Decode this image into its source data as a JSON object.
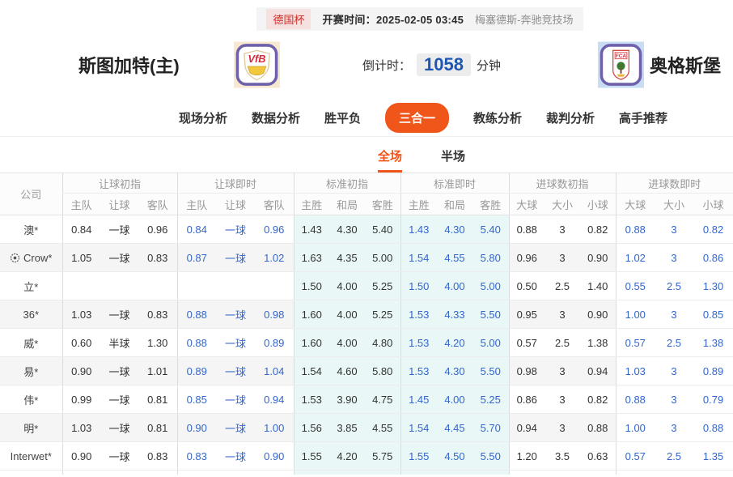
{
  "colors": {
    "accent_orange": "#f0551a",
    "live_blue": "#3366cc",
    "standard_column_bg": "#e9f7f7",
    "league_badge_red": "#c9302c",
    "countdown_blue": "#1e56b0"
  },
  "top_bar": {
    "league": "德国杯",
    "kickoff_label": "开赛时间：",
    "kickoff_time": "2025-02-05 03:45",
    "venue": "梅塞德斯-奔驰竞技场"
  },
  "match_header": {
    "home_team": "斯图加特(主)",
    "home_logo_text": "VfB",
    "away_team": "奥格斯堡",
    "away_logo_text": "FCA",
    "countdown_label": "倒计时：",
    "countdown_value": "1058",
    "countdown_unit": "分钟"
  },
  "nav_tabs": [
    {
      "label": "现场分析",
      "active": false
    },
    {
      "label": "数据分析",
      "active": false
    },
    {
      "label": "胜平负",
      "active": false
    },
    {
      "label": "三合一",
      "active": true
    },
    {
      "label": "教练分析",
      "active": false
    },
    {
      "label": "裁判分析",
      "active": false
    },
    {
      "label": "高手推荐",
      "active": false
    }
  ],
  "sub_tabs": [
    {
      "label": "全场",
      "active": true
    },
    {
      "label": "半场",
      "active": false
    }
  ],
  "odds_table": {
    "company_header": "公司",
    "groups": [
      {
        "label": "让球初指",
        "cols": [
          "主队",
          "让球",
          "客队"
        ],
        "style": "initial"
      },
      {
        "label": "让球即时",
        "cols": [
          "主队",
          "让球",
          "客队"
        ],
        "style": "live"
      },
      {
        "label": "标准初指",
        "cols": [
          "主胜",
          "和局",
          "客胜"
        ],
        "style": "initial-tint"
      },
      {
        "label": "标准即时",
        "cols": [
          "主胜",
          "和局",
          "客胜"
        ],
        "style": "live-tint"
      },
      {
        "label": "进球数初指",
        "cols": [
          "大球",
          "大小",
          "小球"
        ],
        "style": "initial"
      },
      {
        "label": "进球数即时",
        "cols": [
          "大球",
          "大小",
          "小球"
        ],
        "style": "live-white"
      }
    ],
    "rows": [
      {
        "company": "澳*",
        "has_icon": false,
        "cells": [
          [
            "0.84",
            "一球",
            "0.96"
          ],
          [
            "0.84",
            "一球",
            "0.96"
          ],
          [
            "1.43",
            "4.30",
            "5.40"
          ],
          [
            "1.43",
            "4.30",
            "5.40"
          ],
          [
            "0.88",
            "3",
            "0.82"
          ],
          [
            "0.88",
            "3",
            "0.82"
          ]
        ]
      },
      {
        "company": "Crow*",
        "has_icon": true,
        "cells": [
          [
            "1.05",
            "一球",
            "0.83"
          ],
          [
            "0.87",
            "一球",
            "1.02"
          ],
          [
            "1.63",
            "4.35",
            "5.00"
          ],
          [
            "1.54",
            "4.55",
            "5.80"
          ],
          [
            "0.96",
            "3",
            "0.90"
          ],
          [
            "1.02",
            "3",
            "0.86"
          ]
        ]
      },
      {
        "company": "立*",
        "has_icon": false,
        "cells": [
          [
            "",
            "",
            ""
          ],
          [
            "",
            "",
            ""
          ],
          [
            "1.50",
            "4.00",
            "5.25"
          ],
          [
            "1.50",
            "4.00",
            "5.00"
          ],
          [
            "0.50",
            "2.5",
            "1.40"
          ],
          [
            "0.55",
            "2.5",
            "1.30"
          ]
        ]
      },
      {
        "company": "36*",
        "has_icon": false,
        "cells": [
          [
            "1.03",
            "一球",
            "0.83"
          ],
          [
            "0.88",
            "一球",
            "0.98"
          ],
          [
            "1.60",
            "4.00",
            "5.25"
          ],
          [
            "1.53",
            "4.33",
            "5.50"
          ],
          [
            "0.95",
            "3",
            "0.90"
          ],
          [
            "1.00",
            "3",
            "0.85"
          ]
        ]
      },
      {
        "company": "威*",
        "has_icon": false,
        "cells": [
          [
            "0.60",
            "半球",
            "1.30"
          ],
          [
            "0.88",
            "一球",
            "0.89"
          ],
          [
            "1.60",
            "4.00",
            "4.80"
          ],
          [
            "1.53",
            "4.20",
            "5.00"
          ],
          [
            "0.57",
            "2.5",
            "1.38"
          ],
          [
            "0.57",
            "2.5",
            "1.38"
          ]
        ]
      },
      {
        "company": "易*",
        "has_icon": false,
        "cells": [
          [
            "0.90",
            "一球",
            "1.01"
          ],
          [
            "0.89",
            "一球",
            "1.04"
          ],
          [
            "1.54",
            "4.60",
            "5.80"
          ],
          [
            "1.53",
            "4.30",
            "5.50"
          ],
          [
            "0.98",
            "3",
            "0.94"
          ],
          [
            "1.03",
            "3",
            "0.89"
          ]
        ]
      },
      {
        "company": "伟*",
        "has_icon": false,
        "cells": [
          [
            "0.99",
            "一球",
            "0.81"
          ],
          [
            "0.85",
            "一球",
            "0.94"
          ],
          [
            "1.53",
            "3.90",
            "4.75"
          ],
          [
            "1.45",
            "4.00",
            "5.25"
          ],
          [
            "0.86",
            "3",
            "0.82"
          ],
          [
            "0.88",
            "3",
            "0.79"
          ]
        ]
      },
      {
        "company": "明*",
        "has_icon": false,
        "cells": [
          [
            "1.03",
            "一球",
            "0.81"
          ],
          [
            "0.90",
            "一球",
            "1.00"
          ],
          [
            "1.56",
            "3.85",
            "4.55"
          ],
          [
            "1.54",
            "4.45",
            "5.70"
          ],
          [
            "0.94",
            "3",
            "0.88"
          ],
          [
            "1.00",
            "3",
            "0.88"
          ]
        ]
      },
      {
        "company": "Interwet*",
        "has_icon": false,
        "cells": [
          [
            "0.90",
            "一球",
            "0.83"
          ],
          [
            "0.83",
            "一球",
            "0.90"
          ],
          [
            "1.55",
            "4.20",
            "5.75"
          ],
          [
            "1.55",
            "4.50",
            "5.50"
          ],
          [
            "1.20",
            "3.5",
            "0.63"
          ],
          [
            "0.57",
            "2.5",
            "1.35"
          ]
        ]
      }
    ]
  }
}
